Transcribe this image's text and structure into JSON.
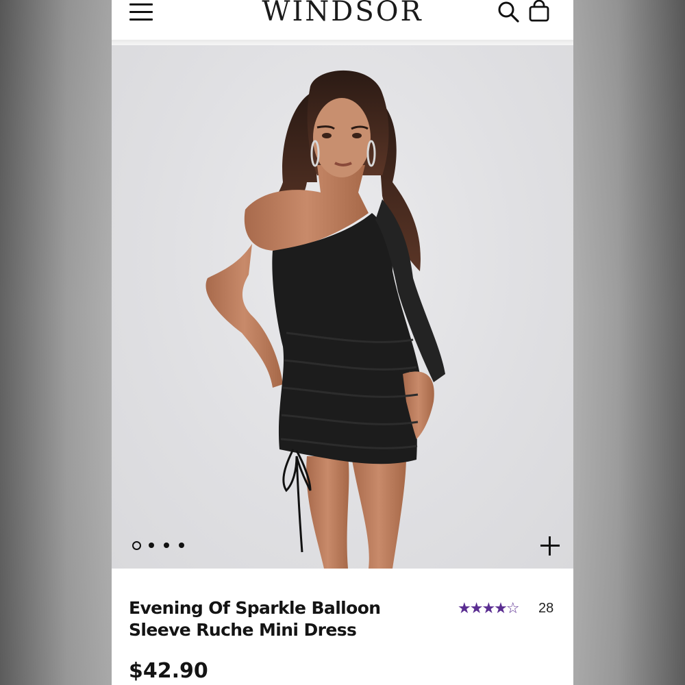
{
  "header": {
    "brand": "WINDSOR",
    "icons": [
      "menu-icon",
      "search-icon",
      "shopping-bag-icon"
    ]
  },
  "gallery": {
    "image_count": 4,
    "active_index": 1,
    "zoom_icon": "plus-icon"
  },
  "product": {
    "title_line1": "Evening Of Sparkle Balloon",
    "title_line2": "Sleeve Ruche Mini Dress",
    "rating": 4.5,
    "stars_display": "★★★★☆",
    "review_count": "28",
    "price": "$42.90"
  },
  "colors": {
    "star": "#5a2d91",
    "text": "#141414",
    "dress": "#1c1c1c"
  }
}
